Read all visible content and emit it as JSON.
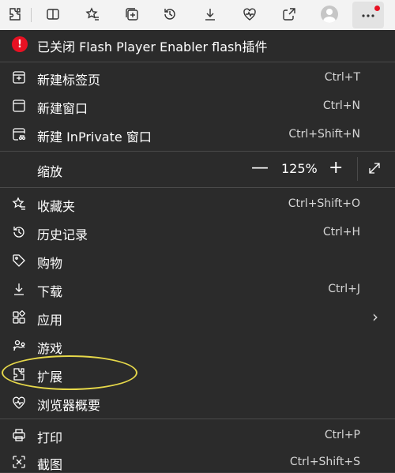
{
  "toolbar": {
    "icons": [
      "extensions-icon",
      "split-screen-icon",
      "favorites-icon",
      "collections-icon",
      "history-icon",
      "downloads-icon",
      "browser-essentials-icon",
      "share-icon",
      "profile-icon",
      "more-icon"
    ]
  },
  "menu": {
    "notice": "已关闭 Flash Player Enabler flash插件",
    "notice_badge": "!",
    "new_tab": {
      "label": "新建标签页",
      "shortcut": "Ctrl+T"
    },
    "new_window": {
      "label": "新建窗口",
      "shortcut": "Ctrl+N"
    },
    "new_inprivate": {
      "label": "新建 InPrivate 窗口",
      "shortcut": "Ctrl+Shift+N"
    },
    "zoom": {
      "label": "缩放",
      "minus": "—",
      "value": "125%",
      "plus": "+"
    },
    "favorites": {
      "label": "收藏夹",
      "shortcut": "Ctrl+Shift+O"
    },
    "history": {
      "label": "历史记录",
      "shortcut": "Ctrl+H"
    },
    "shopping": {
      "label": "购物"
    },
    "downloads": {
      "label": "下载",
      "shortcut": "Ctrl+J"
    },
    "apps": {
      "label": "应用",
      "chevron": "›"
    },
    "games": {
      "label": "游戏"
    },
    "extensions": {
      "label": "扩展"
    },
    "essentials": {
      "label": "浏览器概要"
    },
    "print": {
      "label": "打印",
      "shortcut": "Ctrl+P"
    },
    "screenshot": {
      "label": "截图",
      "shortcut": "Ctrl+Shift+S"
    }
  },
  "colors": {
    "menu_bg": "#2b2b2b",
    "toolbar_bg": "#f3f3f3",
    "alert": "#e81123",
    "highlight": "#e6d84a"
  }
}
